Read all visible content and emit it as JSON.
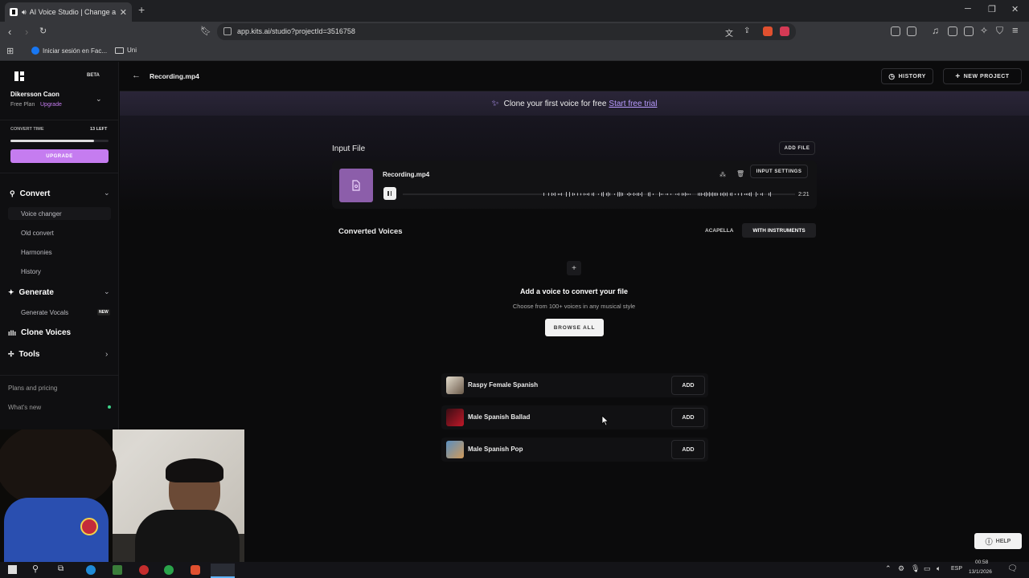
{
  "browser": {
    "tab_title": "AI Voice Studio | Change a vo",
    "url": "app.kits.ai/studio?projectId=3516758",
    "bookmarks": [
      {
        "label": "Iniciar sesión en Fac..."
      },
      {
        "label": "Uni"
      }
    ]
  },
  "sidebar": {
    "badge": "BETA",
    "user_name": "Dikersson Caon",
    "plan": "Free Plan",
    "plan_link": "Upgrade",
    "convert_time_label": "CONVERT TIME",
    "convert_time_left": "13 LEFT",
    "convert_progress": 0.85,
    "upgrade_button": "UPGRADE",
    "sections": {
      "convert": "Convert",
      "generate": "Generate",
      "clone": "Clone Voices",
      "tools": "Tools"
    },
    "convert_items": [
      "Voice changer",
      "Old convert",
      "Harmonies",
      "History"
    ],
    "generate_item": "Generate Vocals",
    "new_badge": "NEW",
    "plans": "Plans and pricing",
    "whats_new": "What's new"
  },
  "topbar": {
    "file_title": "Recording.mp4",
    "history_button": "HISTORY",
    "new_project_button": "NEW PROJECT"
  },
  "banner": {
    "text": "Clone your first voice for free",
    "link": "Start free trial"
  },
  "input_file": {
    "heading": "Input File",
    "add_file_button": "ADD FILE",
    "file_name": "Recording.mp4",
    "input_settings_button": "INPUT SETTINGS",
    "duration": "2:21"
  },
  "converted": {
    "heading": "Converted Voices",
    "acapella_tab": "ACAPELLA",
    "instruments_tab": "WITH INSTRUMENTS",
    "empty_title": "Add a voice to convert your file",
    "empty_subtitle": "Choose from 100+ voices in any musical style",
    "browse_button": "BROWSE ALL"
  },
  "voices": [
    {
      "name": "Raspy Female Spanish",
      "add": "ADD"
    },
    {
      "name": "Male Spanish Ballad",
      "add": "ADD"
    },
    {
      "name": "Male Spanish Pop",
      "add": "ADD"
    }
  ],
  "help_button": "HELP",
  "taskbar": {
    "lang": "ESP",
    "time": "00:58",
    "date": "13/1/2026"
  },
  "colors": {
    "accent": "#c57cf0",
    "banner_bg": "#2a2538",
    "link": "#b99cff"
  }
}
